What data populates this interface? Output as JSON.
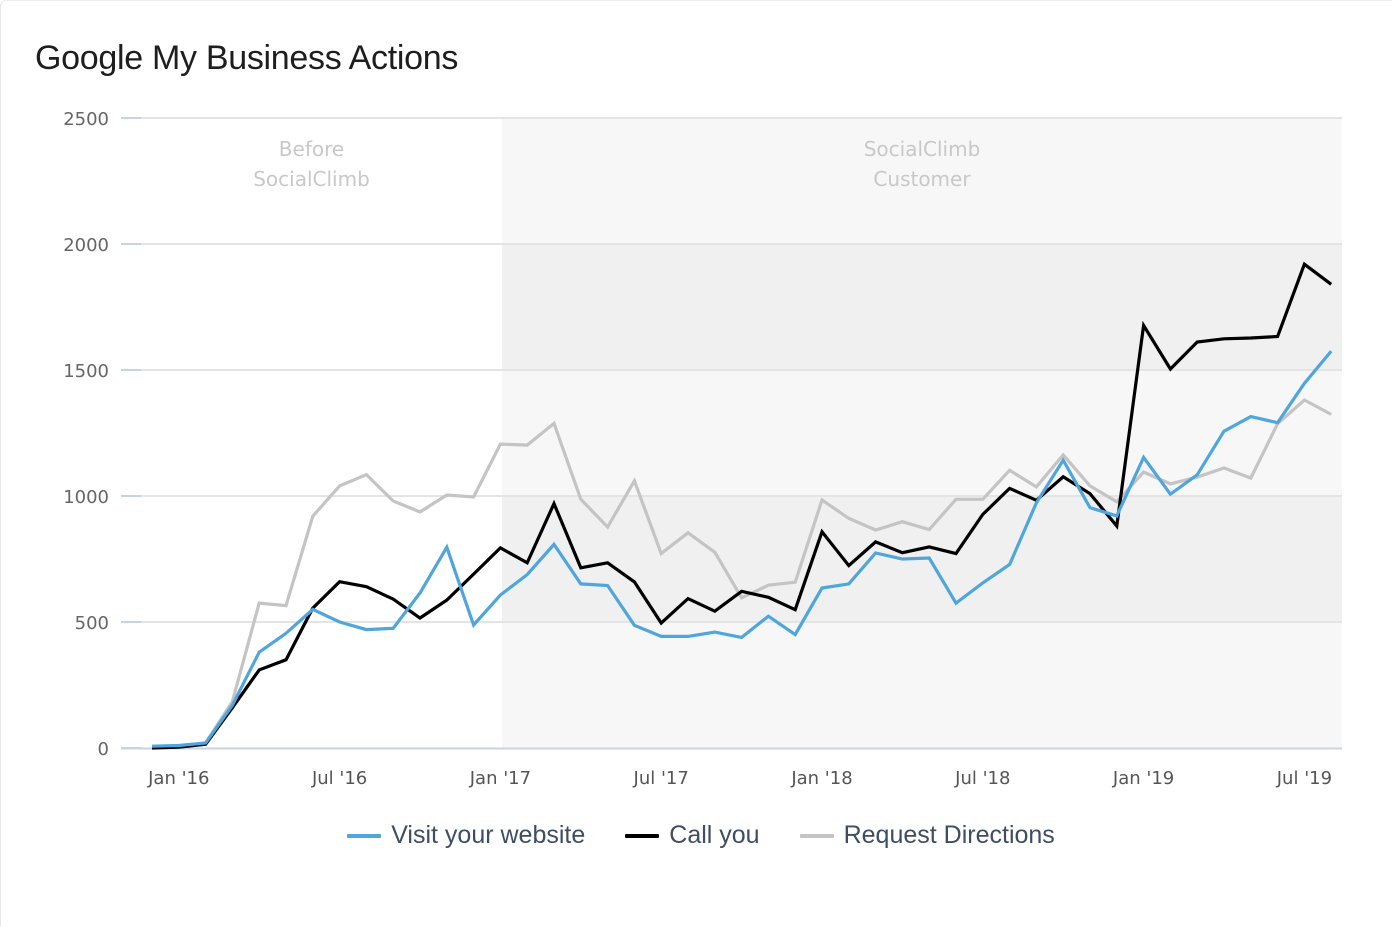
{
  "card": {
    "title": "Google My Business Actions"
  },
  "chart_data": {
    "type": "line",
    "title": "Google My Business Actions",
    "xlabel": "",
    "ylabel": "",
    "ylim": [
      0,
      2500
    ],
    "yticks": [
      0,
      500,
      1000,
      1500,
      2000,
      2500
    ],
    "grid": true,
    "x_start": "Dec 2015",
    "x_end": "Aug 2019",
    "x_ticks": [
      {
        "label": "Jan '16",
        "index": 1
      },
      {
        "label": "Jul '16",
        "index": 7
      },
      {
        "label": "Jan '17",
        "index": 13
      },
      {
        "label": "Jul '17",
        "index": 19
      },
      {
        "label": "Jan '18",
        "index": 25
      },
      {
        "label": "Jul '18",
        "index": 31
      },
      {
        "label": "Jan '19",
        "index": 37
      },
      {
        "label": "Jul '19",
        "index": 43
      }
    ],
    "plot_bands": [
      {
        "label_line1": "Before",
        "label_line2": "SocialClimb",
        "from_index": 0,
        "to_index": 13,
        "shaded": false
      },
      {
        "label_line1": "SocialClimb",
        "label_line2": "Customer",
        "from_index": 13,
        "to_index": 44,
        "shaded": true
      }
    ],
    "legend_position": "bottom-center",
    "series": [
      {
        "name": "Visit your website",
        "color": "#4ea6dc",
        "values": [
          7,
          10,
          20,
          170,
          380,
          455,
          550,
          500,
          470,
          475,
          615,
          797,
          488,
          607,
          688,
          808,
          651,
          645,
          487,
          443,
          443,
          460,
          439,
          523,
          450,
          635,
          651,
          774,
          750,
          754,
          575,
          655,
          728,
          973,
          1142,
          954,
          921,
          1153,
          1007,
          1084,
          1257,
          1315,
          1291,
          1447,
          1575
        ]
      },
      {
        "name": "Call you",
        "color": "#000000",
        "values": [
          0,
          3,
          15,
          160,
          310,
          350,
          555,
          660,
          640,
          591,
          516,
          587,
          690,
          794,
          735,
          970,
          715,
          735,
          659,
          496,
          593,
          543,
          622,
          598,
          549,
          858,
          724,
          818,
          775,
          798,
          772,
          927,
          1030,
          983,
          1076,
          1009,
          881,
          1677,
          1504,
          1611,
          1624,
          1627,
          1633,
          1920,
          1840
        ]
      },
      {
        "name": "Request Directions",
        "color": "#c4c4c4",
        "values": [
          5,
          5,
          20,
          185,
          575,
          565,
          920,
          1040,
          1085,
          980,
          937,
          1004,
          996,
          1206,
          1202,
          1288,
          987,
          877,
          1060,
          772,
          854,
          777,
          596,
          646,
          658,
          984,
          911,
          865,
          898,
          867,
          987,
          987,
          1102,
          1036,
          1163,
          1040,
          977,
          1095,
          1048,
          1075,
          1111,
          1071,
          1287,
          1381,
          1324
        ]
      }
    ]
  }
}
